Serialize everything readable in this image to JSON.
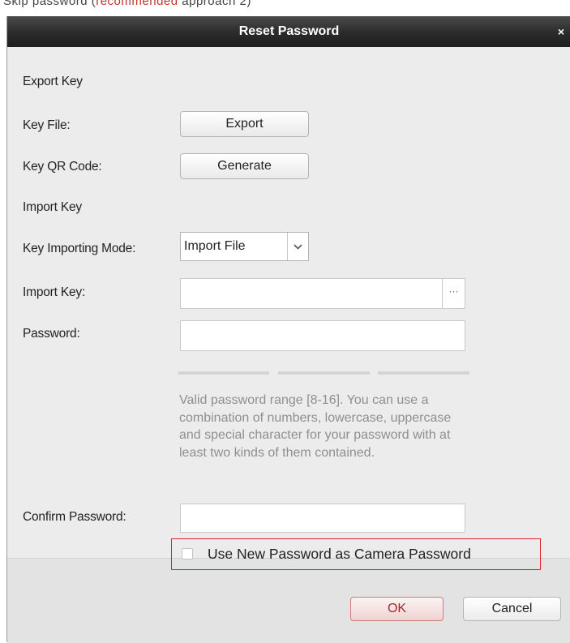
{
  "background_text": {
    "prefix": "Skip password (",
    "highlight": "recommended",
    "suffix": " approach 2)"
  },
  "dialog": {
    "title": "Reset Password",
    "close_glyph": "×"
  },
  "export_section": {
    "heading": "Export Key",
    "key_file_label": "Key File:",
    "export_button": "Export",
    "qr_label": "Key QR Code:",
    "generate_button": "Generate"
  },
  "import_section": {
    "heading": "Import Key",
    "mode_label": "Key Importing Mode:",
    "mode_value": "Import File",
    "import_key_label": "Import Key:",
    "import_key_value": "",
    "browse_button": "···",
    "password_label": "Password:",
    "password_value": "",
    "hint": "Valid password range [8-16]. You can use a combination of numbers, lowercase, uppercase and special character for your password with at least two kinds of them contained.",
    "confirm_label": "Confirm Password:",
    "confirm_value": "",
    "checkbox_label": "Use New Password as Camera Password",
    "checkbox_checked": false
  },
  "footer": {
    "ok_button": "OK",
    "cancel_button": "Cancel"
  },
  "colors": {
    "titlebar": "#2a2a2a",
    "highlight_border": "#e0222d",
    "hint_text": "#8f8f8f",
    "ok_text": "#a02a2a"
  },
  "icons": {
    "close": "close-icon",
    "dropdown": "chevron-down-icon",
    "browse": "ellipsis-icon"
  }
}
